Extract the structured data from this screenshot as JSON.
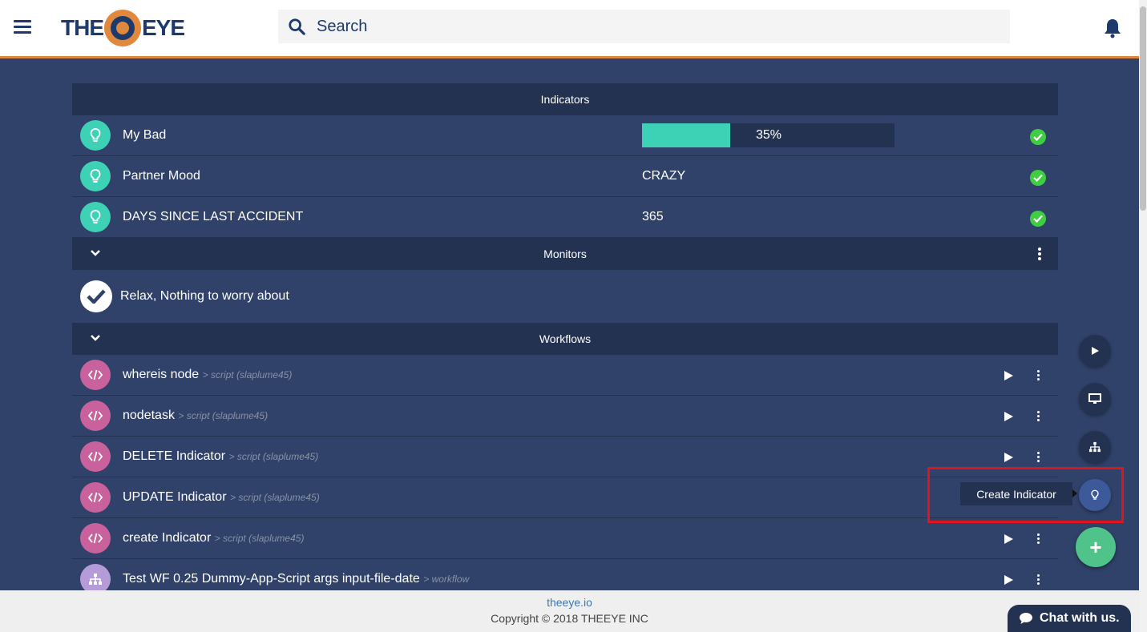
{
  "header": {
    "logo_left": "THE",
    "logo_right": "EYE",
    "search_placeholder": "Search"
  },
  "indicators": {
    "title": "Indicators",
    "items": [
      {
        "name": "My Bad",
        "type": "progress",
        "value": "35%",
        "progress": 35
      },
      {
        "name": "Partner Mood",
        "type": "text",
        "value": "CRAZY"
      },
      {
        "name": "DAYS SINCE LAST ACCIDENT",
        "type": "text",
        "value": "365"
      }
    ]
  },
  "monitors": {
    "title": "Monitors",
    "status_text": "Relax, Nothing to worry about"
  },
  "workflows": {
    "title": "Workflows",
    "items": [
      {
        "name": "whereis node",
        "sub": "> script (slaplume45)",
        "kind": "script"
      },
      {
        "name": "nodetask",
        "sub": "> script (slaplume45)",
        "kind": "script"
      },
      {
        "name": "DELETE Indicator",
        "sub": "> script (slaplume45)",
        "kind": "script"
      },
      {
        "name": "UPDATE Indicator",
        "sub": "> script (slaplume45)",
        "kind": "script"
      },
      {
        "name": "create Indicator",
        "sub": "> script (slaplume45)",
        "kind": "script"
      },
      {
        "name": "Test WF 0.25 Dummy-App-Script args input-file-date",
        "sub": "> workflow",
        "kind": "workflow"
      }
    ]
  },
  "fab": {
    "tooltip": "Create Indicator",
    "main_label": "+"
  },
  "footer": {
    "link": "theeye.io",
    "copyright": "Copyright © 2018 THEEYE INC"
  },
  "chat": {
    "label": "Chat with us."
  },
  "colors": {
    "background": "#304269",
    "header_band": "#233250",
    "accent_orange": "#e0883d",
    "teal": "#3dd1b6",
    "pink": "#c9619d",
    "check_green": "#3fce42",
    "fab_green": "#4fc38a",
    "highlight_red": "#e0141b"
  }
}
